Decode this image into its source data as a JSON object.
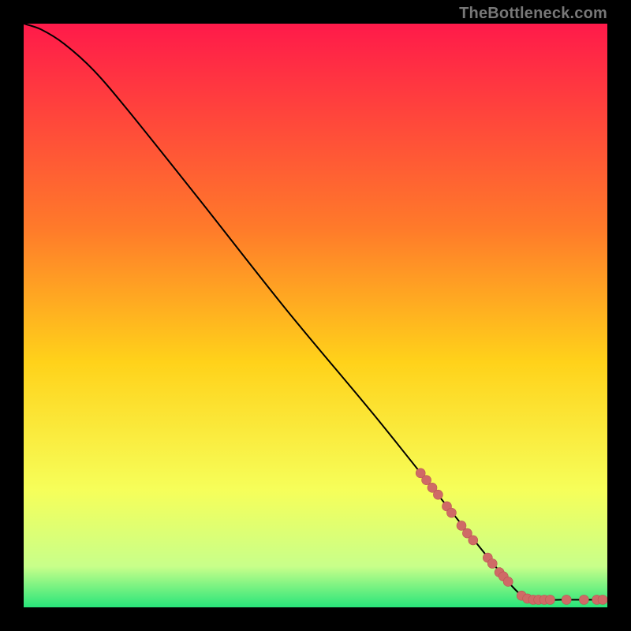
{
  "watermark": "TheBottleneck.com",
  "colors": {
    "background": "#000000",
    "gradient_top": "#ff1a4a",
    "gradient_mid1": "#ff7a2a",
    "gradient_mid2": "#ffd21a",
    "gradient_mid3": "#f6ff5a",
    "gradient_mid4": "#c8ff8a",
    "gradient_bottom": "#28e57a",
    "curve": "#000000",
    "marker_fill": "#cf6a66",
    "marker_stroke": "#b95552"
  },
  "chart_data": {
    "type": "line",
    "title": "",
    "xlabel": "",
    "ylabel": "",
    "xlim": [
      0,
      100
    ],
    "ylim": [
      0,
      100
    ],
    "grid": false,
    "legend": false,
    "curve": [
      {
        "x": 0,
        "y": 100
      },
      {
        "x": 3,
        "y": 99
      },
      {
        "x": 7,
        "y": 96.5
      },
      {
        "x": 12,
        "y": 92
      },
      {
        "x": 18,
        "y": 85
      },
      {
        "x": 30,
        "y": 70
      },
      {
        "x": 45,
        "y": 51
      },
      {
        "x": 60,
        "y": 33
      },
      {
        "x": 72,
        "y": 18
      },
      {
        "x": 80,
        "y": 8
      },
      {
        "x": 85,
        "y": 2.3
      },
      {
        "x": 88,
        "y": 1.3
      },
      {
        "x": 92,
        "y": 1.3
      },
      {
        "x": 96,
        "y": 1.3
      },
      {
        "x": 100,
        "y": 1.3
      }
    ],
    "markers": [
      {
        "x": 68.0,
        "y": 23.0,
        "r": 6
      },
      {
        "x": 69.0,
        "y": 21.8,
        "r": 6
      },
      {
        "x": 70.0,
        "y": 20.5,
        "r": 6
      },
      {
        "x": 71.0,
        "y": 19.3,
        "r": 6
      },
      {
        "x": 72.5,
        "y": 17.3,
        "r": 6
      },
      {
        "x": 73.3,
        "y": 16.2,
        "r": 6
      },
      {
        "x": 75.0,
        "y": 14.0,
        "r": 6
      },
      {
        "x": 76.0,
        "y": 12.7,
        "r": 6
      },
      {
        "x": 77.0,
        "y": 11.5,
        "r": 6
      },
      {
        "x": 79.5,
        "y": 8.5,
        "r": 6
      },
      {
        "x": 80.3,
        "y": 7.5,
        "r": 6
      },
      {
        "x": 81.5,
        "y": 6.0,
        "r": 6
      },
      {
        "x": 82.2,
        "y": 5.3,
        "r": 6
      },
      {
        "x": 83.0,
        "y": 4.4,
        "r": 6
      },
      {
        "x": 85.3,
        "y": 2.0,
        "r": 6
      },
      {
        "x": 86.3,
        "y": 1.5,
        "r": 6
      },
      {
        "x": 87.3,
        "y": 1.3,
        "r": 6
      },
      {
        "x": 88.2,
        "y": 1.3,
        "r": 6
      },
      {
        "x": 89.2,
        "y": 1.3,
        "r": 6
      },
      {
        "x": 90.2,
        "y": 1.3,
        "r": 6
      },
      {
        "x": 93.0,
        "y": 1.3,
        "r": 6
      },
      {
        "x": 96.0,
        "y": 1.3,
        "r": 6
      },
      {
        "x": 98.2,
        "y": 1.3,
        "r": 6
      },
      {
        "x": 99.2,
        "y": 1.3,
        "r": 6
      }
    ]
  }
}
